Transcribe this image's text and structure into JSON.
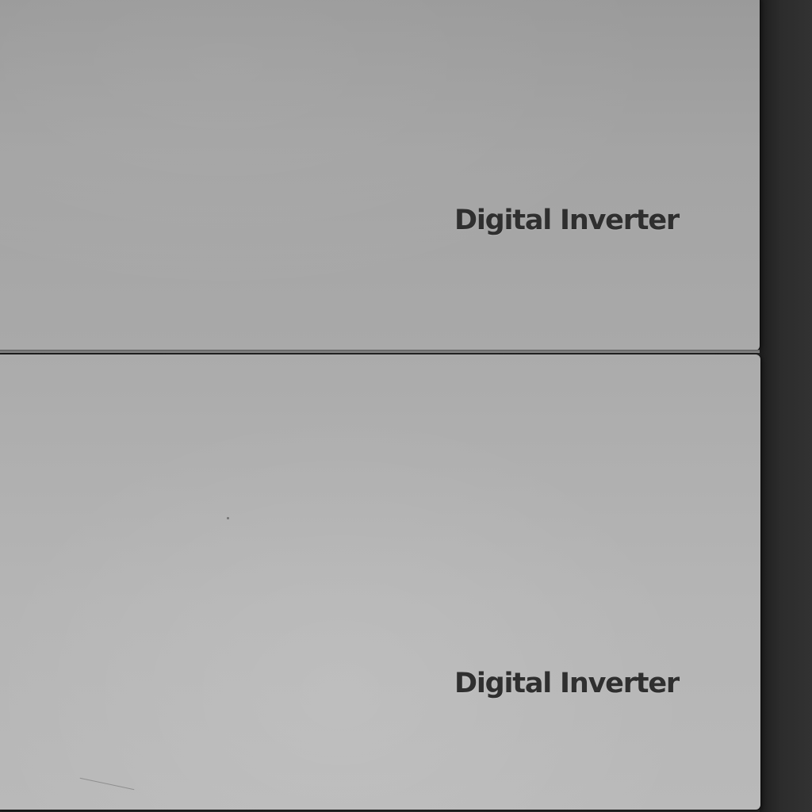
{
  "photo": {
    "panels": [
      {
        "logo_text": "Digital Inverter"
      },
      {
        "logo_text": "Digital Inverter"
      }
    ]
  }
}
